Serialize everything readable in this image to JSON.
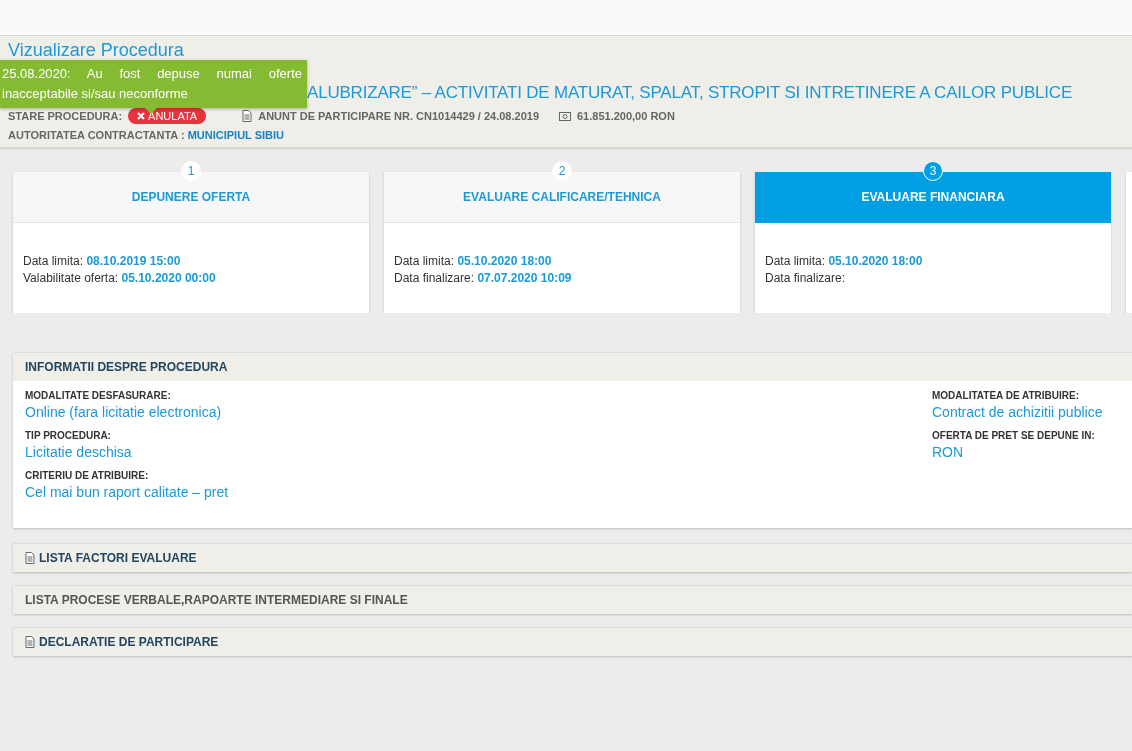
{
  "header": {
    "title": "Vizualizare Procedura",
    "headline": "ALUBRIZARE” – ACTIVITATI DE MATURAT, SPALAT, STROPIT SI INTRETINERE A CAILOR PUBLICE",
    "tooltip": "25.08.2020: Au fost depuse numai oferte inacceptabile si/sau neconforme",
    "status_label": "STARE PROCEDURA:",
    "status_badge": "ANULATA",
    "notice": "ANUNT DE PARTICIPARE NR. CN1014429 / 24.08.2019",
    "value": "61.851.200,00  RON",
    "authority_label": "AUTORITATEA CONTRACTANTA :",
    "authority": "MUNICIPIUL SIBIU"
  },
  "steps": [
    {
      "number": "1",
      "title": "DEPUNERE OFERTA",
      "selected": false,
      "lines": [
        {
          "label": "Data limita:",
          "value": "08.10.2019 15:00"
        },
        {
          "label": "Valabilitate oferta:",
          "value": "05.10.2020 00:00"
        }
      ]
    },
    {
      "number": "2",
      "title": "EVALUARE CALIFICARE/TEHNICA",
      "selected": false,
      "lines": [
        {
          "label": "Data limita:",
          "value": "05.10.2020 18:00"
        },
        {
          "label": "Data finalizare:",
          "value": "07.07.2020 10:09"
        }
      ]
    },
    {
      "number": "3",
      "title": "EVALUARE FINANCIARA",
      "selected": true,
      "lines": [
        {
          "label": "Data limita:",
          "value": "05.10.2020 18:00"
        },
        {
          "label": "Data finalizare:"
        }
      ]
    }
  ],
  "info": {
    "title": "INFORMATII DESPRE PROCEDURA",
    "left": [
      {
        "label": "MODALITATE DESFASURARE:",
        "value": "Online (fara licitatie electronica)"
      },
      {
        "label": "TIP PROCEDURA:",
        "value": "Licitatie deschisa"
      },
      {
        "label": "CRITERIU DE ATRIBUIRE:",
        "value": "Cel mai bun raport calitate – pret"
      }
    ],
    "right": [
      {
        "label": "MODALITATEA DE ATRIBUIRE:",
        "value": "Contract de achizitii publice"
      },
      {
        "label": "OFERTA DE PRET SE DEPUNE IN:",
        "value": "RON"
      }
    ]
  },
  "sections": [
    {
      "title": "LISTA FACTORI EVALUARE",
      "has_icon": true,
      "disabled": false
    },
    {
      "title": "LISTA PROCESE VERBALE,RAPOARTE INTERMEDIARE SI FINALE",
      "has_icon": false,
      "disabled": true
    },
    {
      "title": "DECLARATIE DE PARTICIPARE",
      "has_icon": true,
      "disabled": false
    }
  ]
}
